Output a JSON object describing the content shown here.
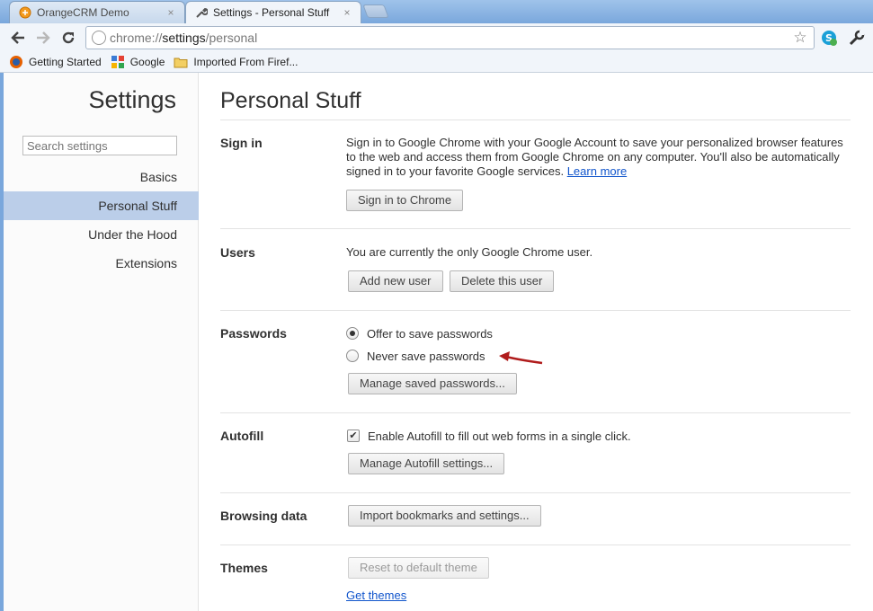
{
  "browser": {
    "tabs": [
      {
        "title": "OrangeCRM Demo",
        "close": "×",
        "active": false
      },
      {
        "title": "Settings - Personal Stuff",
        "close": "×",
        "active": true
      }
    ],
    "url_prefix": "chrome://",
    "url_host": "settings",
    "url_path": "/personal",
    "bookmarks": [
      {
        "label": "Getting Started",
        "icon": "firefox-icon"
      },
      {
        "label": "Google",
        "icon": "google-icon"
      },
      {
        "label": "Imported From Firef...",
        "icon": "folder-icon"
      }
    ]
  },
  "sidebar": {
    "title": "Settings",
    "search_placeholder": "Search settings",
    "items": [
      {
        "label": "Basics",
        "selected": false
      },
      {
        "label": "Personal Stuff",
        "selected": true
      },
      {
        "label": "Under the Hood",
        "selected": false
      },
      {
        "label": "Extensions",
        "selected": false
      }
    ]
  },
  "main": {
    "title": "Personal Stuff",
    "signin": {
      "label": "Sign in",
      "line1": "Sign in to Google Chrome with your Google Account to save your personalized browser features",
      "line2": "to the web and access them from Google Chrome on any computer. You'll also be automatically",
      "line3": "signed in to your favorite Google services.",
      "learn_more": "Learn more",
      "button": "Sign in to Chrome"
    },
    "users": {
      "label": "Users",
      "text": "You are currently the only Google Chrome user.",
      "add_button": "Add new user",
      "delete_button": "Delete this user"
    },
    "passwords": {
      "label": "Passwords",
      "offer": "Offer to save passwords",
      "never": "Never save passwords",
      "selected": "offer",
      "manage_button": "Manage saved passwords..."
    },
    "autofill": {
      "label": "Autofill",
      "checkbox_label": "Enable Autofill to fill out web forms in a single click.",
      "checked": true,
      "manage_button": "Manage Autofill settings..."
    },
    "browsing": {
      "label": "Browsing data",
      "import_button": "Import bookmarks and settings..."
    },
    "themes": {
      "label": "Themes",
      "reset_button": "Reset to default theme",
      "get_themes": "Get themes"
    }
  },
  "annotation": {
    "arrow_color": "#b01c1c"
  },
  "colors": {
    "selected_nav": "#bbcee9",
    "link": "#1155cc",
    "frame": "#7aa7dc"
  }
}
